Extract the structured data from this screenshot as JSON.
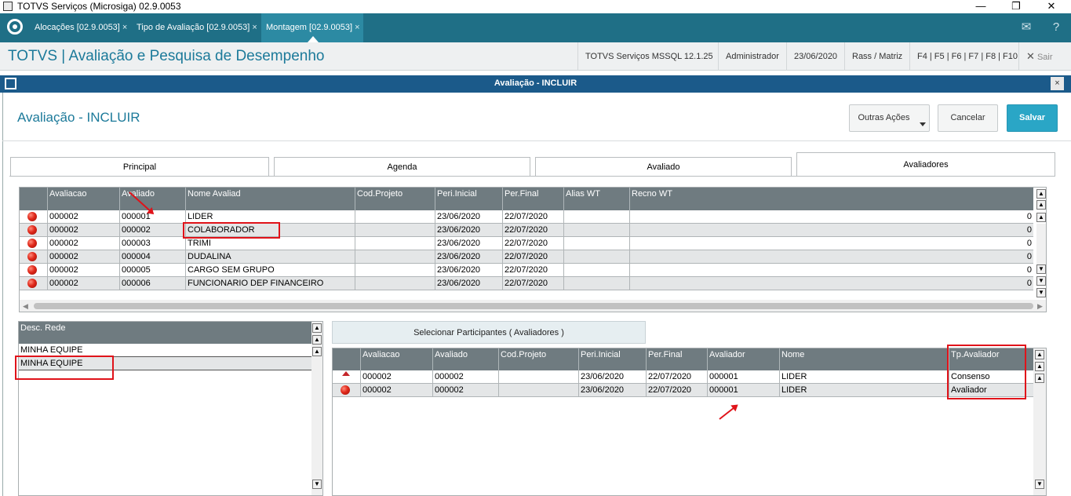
{
  "window": {
    "title": "TOTVS Serviços (Microsiga) 02.9.0053",
    "minimize": "—",
    "maximize": "❐",
    "close": "✕"
  },
  "tabs": [
    {
      "label": "Alocações [02.9.0053]"
    },
    {
      "label": "Tipo de Avaliação [02.9.0053]"
    },
    {
      "label": "Montagem [02.9.0053]"
    }
  ],
  "tab_close": "×",
  "module": {
    "title": "TOTVS | Avaliação e Pesquisa de Desempenho",
    "server": "TOTVS Serviços MSSQL 12.1.25",
    "user": "Administrador",
    "date": "23/06/2020",
    "branch": "Rass / Matriz",
    "keys": "F4 | F5 | F6 | F7 | F8 | F10",
    "exit_icon": "✕",
    "exit": "Sair"
  },
  "dialog": {
    "title": "Avaliação - INCLUIR",
    "close": "×"
  },
  "form": {
    "title": "Avaliação - INCLUIR",
    "other_actions": "Outras Ações",
    "cancel": "Cancelar",
    "save": "Salvar"
  },
  "form_tabs": [
    "Principal",
    "Agenda",
    "Avaliado",
    "Avaliadores"
  ],
  "top_grid": {
    "headers": [
      "Avaliacao",
      "Avaliado",
      "Nome Avaliad",
      "Cod.Projeto",
      "Peri.Inicial",
      "Per.Final",
      "Alias WT",
      "Recno WT"
    ],
    "rows": [
      [
        "000002",
        "000001",
        "LIDER",
        "",
        "23/06/2020",
        "22/07/2020",
        "",
        "0"
      ],
      [
        "000002",
        "000002",
        "COLABORADOR",
        "",
        "23/06/2020",
        "22/07/2020",
        "",
        "0"
      ],
      [
        "000002",
        "000003",
        "TRIMI",
        "",
        "23/06/2020",
        "22/07/2020",
        "",
        "0"
      ],
      [
        "000002",
        "000004",
        "DUDALINA",
        "",
        "23/06/2020",
        "22/07/2020",
        "",
        "0"
      ],
      [
        "000002",
        "000005",
        "CARGO SEM GRUPO",
        "",
        "23/06/2020",
        "22/07/2020",
        "",
        "0"
      ],
      [
        "000002",
        "000006",
        "FUNCIONARIO DEP FINANCEIRO",
        "",
        "23/06/2020",
        "22/07/2020",
        "",
        "0"
      ]
    ]
  },
  "rede_grid": {
    "header": "Desc. Rede",
    "rows": [
      "MINHA EQUIPE",
      "MINHA EQUIPE"
    ]
  },
  "select_button": "Selecionar Participantes ( Avaliadores )",
  "eval_grid": {
    "headers": [
      "Avaliacao",
      "Avaliado",
      "Cod.Projeto",
      "Peri.Inicial",
      "Per.Final",
      "Avaliador",
      "Nome",
      "Tp.Avaliador"
    ],
    "rows": [
      [
        "000002",
        "000002",
        "",
        "23/06/2020",
        "22/07/2020",
        "000001",
        "LIDER",
        "Consenso"
      ],
      [
        "000002",
        "000002",
        "",
        "23/06/2020",
        "22/07/2020",
        "000001",
        "LIDER",
        "Avaliador"
      ]
    ]
  },
  "colors": {
    "tabbar": "#1f6f86",
    "accent": "#1c7a9a",
    "dialog_bar": "#1b5a8a",
    "save": "#2aa6c6",
    "annotation": "#e0131a"
  }
}
